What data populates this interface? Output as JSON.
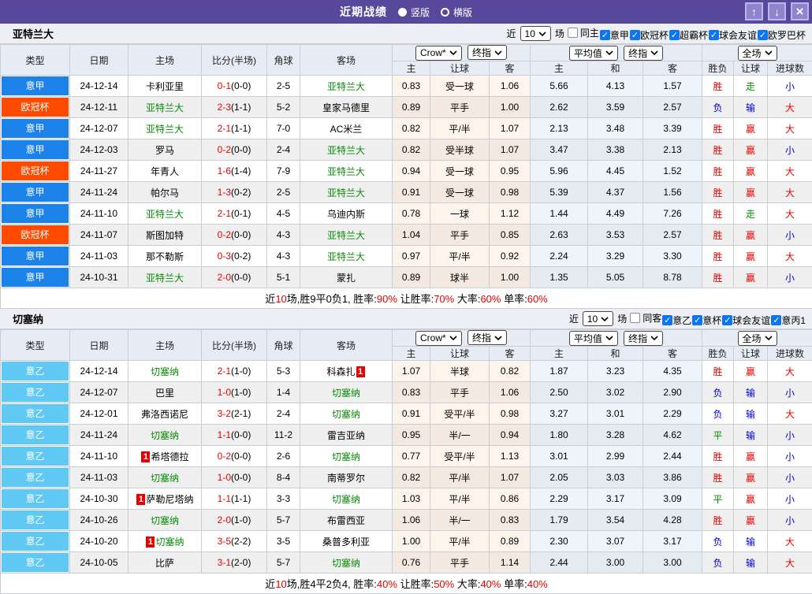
{
  "titlebar": {
    "title": "近期战绩",
    "radios": [
      {
        "label": "竖版",
        "selected": true
      },
      {
        "label": "横版",
        "selected": false
      }
    ],
    "buttons": {
      "up": "↑",
      "down": "↓",
      "close": "×"
    }
  },
  "columns": {
    "left": [
      "类型",
      "日期",
      "主场",
      "比分(半场)",
      "角球",
      "客场"
    ],
    "g1_select_1": "Crow*",
    "g1_select_2": "终指",
    "g1_cols": [
      "主",
      "让球",
      "客"
    ],
    "g2_select_1": "平均值",
    "g2_select_2": "终指",
    "g2_cols": [
      "主",
      "和",
      "客"
    ],
    "g3_select": "全场",
    "g3_cols": [
      "胜负",
      "让球",
      "进球数"
    ]
  },
  "league_colors": {
    "意甲": "#1a82e8",
    "欧冠杯": "#ff4b00",
    "意乙": "#5fc8f3"
  },
  "colors": {
    "titlebar": "#57489b",
    "win": "#e60000",
    "lose": "#0000d0",
    "draw": "#088a08",
    "highlight_team": "#088a08"
  },
  "sections": [
    {
      "team": "亚特兰大",
      "filter": {
        "prefix": "近",
        "count": "10",
        "suffix": "场",
        "items": [
          {
            "label": "同主",
            "checked": false
          },
          {
            "label": "意甲",
            "checked": true
          },
          {
            "label": "欧冠杯",
            "checked": true
          },
          {
            "label": "超霸杯",
            "checked": true
          },
          {
            "label": "球会友谊",
            "checked": true
          },
          {
            "label": "欧罗巴杯",
            "checked": true
          }
        ]
      },
      "rows": [
        {
          "lg": "意甲",
          "dt": "24-12-14",
          "hm": {
            "n": "卡利亚里"
          },
          "sc": "0-1",
          "hf": "0-0",
          "cn": "2-5",
          "aw": {
            "n": "亚特兰大",
            "hl": 1
          },
          "o": [
            "0.83",
            "受一球",
            "1.06"
          ],
          "avg": [
            "5.66",
            "4.13",
            "1.57"
          ],
          "res": [
            [
              "胜",
              "r"
            ],
            [
              "走",
              "g"
            ],
            [
              "小",
              "b"
            ]
          ]
        },
        {
          "lg": "欧冠杯",
          "dt": "24-12-11",
          "hm": {
            "n": "亚特兰大",
            "hl": 1
          },
          "sc": "2-3",
          "hf": "1-1",
          "cn": "5-2",
          "aw": {
            "n": "皇家马德里"
          },
          "o": [
            "0.89",
            "平手",
            "1.00"
          ],
          "avg": [
            "2.62",
            "3.59",
            "2.57"
          ],
          "res": [
            [
              "负",
              "b"
            ],
            [
              "输",
              "b"
            ],
            [
              "大",
              "r"
            ]
          ]
        },
        {
          "lg": "意甲",
          "dt": "24-12-07",
          "hm": {
            "n": "亚特兰大",
            "hl": 1
          },
          "sc": "2-1",
          "hf": "1-1",
          "cn": "7-0",
          "aw": {
            "n": "AC米兰"
          },
          "o": [
            "0.82",
            "平/半",
            "1.07"
          ],
          "avg": [
            "2.13",
            "3.48",
            "3.39"
          ],
          "res": [
            [
              "胜",
              "r"
            ],
            [
              "赢",
              "r"
            ],
            [
              "大",
              "r"
            ]
          ]
        },
        {
          "lg": "意甲",
          "dt": "24-12-03",
          "hm": {
            "n": "罗马"
          },
          "sc": "0-2",
          "hf": "0-0",
          "cn": "2-4",
          "aw": {
            "n": "亚特兰大",
            "hl": 1
          },
          "o": [
            "0.82",
            "受半球",
            "1.07"
          ],
          "avg": [
            "3.47",
            "3.38",
            "2.13"
          ],
          "res": [
            [
              "胜",
              "r"
            ],
            [
              "赢",
              "r"
            ],
            [
              "小",
              "b"
            ]
          ]
        },
        {
          "lg": "欧冠杯",
          "dt": "24-11-27",
          "hm": {
            "n": "年青人"
          },
          "sc": "1-6",
          "hf": "1-4",
          "cn": "7-9",
          "aw": {
            "n": "亚特兰大",
            "hl": 1
          },
          "o": [
            "0.94",
            "受一球",
            "0.95"
          ],
          "avg": [
            "5.96",
            "4.45",
            "1.52"
          ],
          "res": [
            [
              "胜",
              "r"
            ],
            [
              "赢",
              "r"
            ],
            [
              "大",
              "r"
            ]
          ]
        },
        {
          "lg": "意甲",
          "dt": "24-11-24",
          "hm": {
            "n": "帕尔马"
          },
          "sc": "1-3",
          "hf": "0-2",
          "cn": "2-5",
          "aw": {
            "n": "亚特兰大",
            "hl": 1
          },
          "o": [
            "0.91",
            "受一球",
            "0.98"
          ],
          "avg": [
            "5.39",
            "4.37",
            "1.56"
          ],
          "res": [
            [
              "胜",
              "r"
            ],
            [
              "赢",
              "r"
            ],
            [
              "大",
              "r"
            ]
          ]
        },
        {
          "lg": "意甲",
          "dt": "24-11-10",
          "hm": {
            "n": "亚特兰大",
            "hl": 1
          },
          "sc": "2-1",
          "hf": "0-1",
          "cn": "4-5",
          "aw": {
            "n": "乌迪内斯"
          },
          "o": [
            "0.78",
            "一球",
            "1.12"
          ],
          "avg": [
            "1.44",
            "4.49",
            "7.26"
          ],
          "res": [
            [
              "胜",
              "r"
            ],
            [
              "走",
              "g"
            ],
            [
              "大",
              "r"
            ]
          ]
        },
        {
          "lg": "欧冠杯",
          "dt": "24-11-07",
          "hm": {
            "n": "斯图加特"
          },
          "sc": "0-2",
          "hf": "0-0",
          "cn": "4-3",
          "aw": {
            "n": "亚特兰大",
            "hl": 1
          },
          "o": [
            "1.04",
            "平手",
            "0.85"
          ],
          "avg": [
            "2.63",
            "3.53",
            "2.57"
          ],
          "res": [
            [
              "胜",
              "r"
            ],
            [
              "赢",
              "r"
            ],
            [
              "小",
              "b"
            ]
          ]
        },
        {
          "lg": "意甲",
          "dt": "24-11-03",
          "hm": {
            "n": "那不勒斯"
          },
          "sc": "0-3",
          "hf": "0-2",
          "cn": "4-3",
          "aw": {
            "n": "亚特兰大",
            "hl": 1
          },
          "o": [
            "0.97",
            "平/半",
            "0.92"
          ],
          "avg": [
            "2.24",
            "3.29",
            "3.30"
          ],
          "res": [
            [
              "胜",
              "r"
            ],
            [
              "赢",
              "r"
            ],
            [
              "大",
              "r"
            ]
          ]
        },
        {
          "lg": "意甲",
          "dt": "24-10-31",
          "hm": {
            "n": "亚特兰大",
            "hl": 1
          },
          "sc": "2-0",
          "hf": "0-0",
          "cn": "5-1",
          "aw": {
            "n": "蒙扎"
          },
          "o": [
            "0.89",
            "球半",
            "1.00"
          ],
          "avg": [
            "1.35",
            "5.05",
            "8.78"
          ],
          "res": [
            [
              "胜",
              "r"
            ],
            [
              "赢",
              "r"
            ],
            [
              "小",
              "b"
            ]
          ]
        }
      ],
      "summary": [
        {
          "t": "近"
        },
        {
          "t": "10",
          "c": "r"
        },
        {
          "t": "场,胜9平0负1, 胜率:"
        },
        {
          "t": "90%",
          "c": "r"
        },
        {
          "t": " 让胜率:"
        },
        {
          "t": "70%",
          "c": "r"
        },
        {
          "t": " 大率:"
        },
        {
          "t": "60%",
          "c": "r"
        },
        {
          "t": " 单率:"
        },
        {
          "t": "60%",
          "c": "r"
        }
      ]
    },
    {
      "team": "切塞纳",
      "filter": {
        "prefix": "近",
        "count": "10",
        "suffix": "场",
        "items": [
          {
            "label": "同客",
            "checked": false
          },
          {
            "label": "意乙",
            "checked": true
          },
          {
            "label": "意杯",
            "checked": true
          },
          {
            "label": "球会友谊",
            "checked": true
          },
          {
            "label": "意丙1",
            "checked": true
          }
        ]
      },
      "rows": [
        {
          "lg": "意乙",
          "dt": "24-12-14",
          "hm": {
            "n": "切塞纳",
            "hl": 1
          },
          "sc": "2-1",
          "hf": "1-0",
          "cn": "5-3",
          "aw": {
            "n": "科森扎",
            "bd": "1",
            "bp": "a"
          },
          "o": [
            "1.07",
            "半球",
            "0.82"
          ],
          "avg": [
            "1.87",
            "3.23",
            "4.35"
          ],
          "res": [
            [
              "胜",
              "r"
            ],
            [
              "赢",
              "r"
            ],
            [
              "大",
              "r"
            ]
          ]
        },
        {
          "lg": "意乙",
          "dt": "24-12-07",
          "hm": {
            "n": "巴里"
          },
          "sc": "1-0",
          "hf": "1-0",
          "cn": "1-4",
          "aw": {
            "n": "切塞纳",
            "hl": 1
          },
          "o": [
            "0.83",
            "平手",
            "1.06"
          ],
          "avg": [
            "2.50",
            "3.02",
            "2.90"
          ],
          "res": [
            [
              "负",
              "b"
            ],
            [
              "输",
              "b"
            ],
            [
              "小",
              "b"
            ]
          ]
        },
        {
          "lg": "意乙",
          "dt": "24-12-01",
          "hm": {
            "n": "弗洛西诺尼"
          },
          "sc": "3-2",
          "hf": "2-1",
          "cn": "2-4",
          "aw": {
            "n": "切塞纳",
            "hl": 1
          },
          "o": [
            "0.91",
            "受平/半",
            "0.98"
          ],
          "avg": [
            "3.27",
            "3.01",
            "2.29"
          ],
          "res": [
            [
              "负",
              "b"
            ],
            [
              "输",
              "b"
            ],
            [
              "大",
              "r"
            ]
          ]
        },
        {
          "lg": "意乙",
          "dt": "24-11-24",
          "hm": {
            "n": "切塞纳",
            "hl": 1
          },
          "sc": "1-1",
          "hf": "0-0",
          "cn": "11-2",
          "aw": {
            "n": "雷吉亚纳"
          },
          "o": [
            "0.95",
            "半/一",
            "0.94"
          ],
          "avg": [
            "1.80",
            "3.28",
            "4.62"
          ],
          "res": [
            [
              "平",
              "g"
            ],
            [
              "输",
              "b"
            ],
            [
              "小",
              "b"
            ]
          ]
        },
        {
          "lg": "意乙",
          "dt": "24-11-10",
          "hm": {
            "n": "希塔德拉",
            "bd": "1",
            "bp": "b"
          },
          "sc": "0-2",
          "hf": "0-0",
          "cn": "2-6",
          "aw": {
            "n": "切塞纳",
            "hl": 1
          },
          "o": [
            "0.77",
            "受平/半",
            "1.13"
          ],
          "avg": [
            "3.01",
            "2.99",
            "2.44"
          ],
          "res": [
            [
              "胜",
              "r"
            ],
            [
              "赢",
              "r"
            ],
            [
              "小",
              "b"
            ]
          ]
        },
        {
          "lg": "意乙",
          "dt": "24-11-03",
          "hm": {
            "n": "切塞纳",
            "hl": 1
          },
          "sc": "1-0",
          "hf": "0-0",
          "cn": "8-4",
          "aw": {
            "n": "南蒂罗尔"
          },
          "o": [
            "0.82",
            "平/半",
            "1.07"
          ],
          "avg": [
            "2.05",
            "3.03",
            "3.86"
          ],
          "res": [
            [
              "胜",
              "r"
            ],
            [
              "赢",
              "r"
            ],
            [
              "小",
              "b"
            ]
          ]
        },
        {
          "lg": "意乙",
          "dt": "24-10-30",
          "hm": {
            "n": "萨勒尼塔纳",
            "bd": "1",
            "bp": "b"
          },
          "sc": "1-1",
          "hf": "1-1",
          "cn": "3-3",
          "aw": {
            "n": "切塞纳",
            "hl": 1
          },
          "o": [
            "1.03",
            "平/半",
            "0.86"
          ],
          "avg": [
            "2.29",
            "3.17",
            "3.09"
          ],
          "res": [
            [
              "平",
              "g"
            ],
            [
              "赢",
              "r"
            ],
            [
              "小",
              "b"
            ]
          ]
        },
        {
          "lg": "意乙",
          "dt": "24-10-26",
          "hm": {
            "n": "切塞纳",
            "hl": 1
          },
          "sc": "2-0",
          "hf": "1-0",
          "cn": "5-7",
          "aw": {
            "n": "布雷西亚"
          },
          "o": [
            "1.06",
            "半/一",
            "0.83"
          ],
          "avg": [
            "1.79",
            "3.54",
            "4.28"
          ],
          "res": [
            [
              "胜",
              "r"
            ],
            [
              "赢",
              "r"
            ],
            [
              "小",
              "b"
            ]
          ]
        },
        {
          "lg": "意乙",
          "dt": "24-10-20",
          "hm": {
            "n": "切塞纳",
            "hl": 1,
            "bd": "1",
            "bp": "b"
          },
          "sc": "3-5",
          "hf": "2-2",
          "cn": "3-5",
          "aw": {
            "n": "桑普多利亚"
          },
          "o": [
            "1.00",
            "平/半",
            "0.89"
          ],
          "avg": [
            "2.30",
            "3.07",
            "3.17"
          ],
          "res": [
            [
              "负",
              "b"
            ],
            [
              "输",
              "b"
            ],
            [
              "大",
              "r"
            ]
          ]
        },
        {
          "lg": "意乙",
          "dt": "24-10-05",
          "hm": {
            "n": "比萨"
          },
          "sc": "3-1",
          "hf": "2-0",
          "cn": "5-7",
          "aw": {
            "n": "切塞纳",
            "hl": 1
          },
          "o": [
            "0.76",
            "平手",
            "1.14"
          ],
          "avg": [
            "2.44",
            "3.00",
            "3.00"
          ],
          "res": [
            [
              "负",
              "b"
            ],
            [
              "输",
              "b"
            ],
            [
              "大",
              "r"
            ]
          ]
        }
      ],
      "summary": [
        {
          "t": "近"
        },
        {
          "t": "10",
          "c": "r"
        },
        {
          "t": "场,胜4平2负4, 胜率:"
        },
        {
          "t": "40%",
          "c": "r"
        },
        {
          "t": " 让胜率:"
        },
        {
          "t": "50%",
          "c": "r"
        },
        {
          "t": " 大率:"
        },
        {
          "t": "40%",
          "c": "r"
        },
        {
          "t": " 单率:"
        },
        {
          "t": "40%",
          "c": "r"
        }
      ]
    }
  ]
}
